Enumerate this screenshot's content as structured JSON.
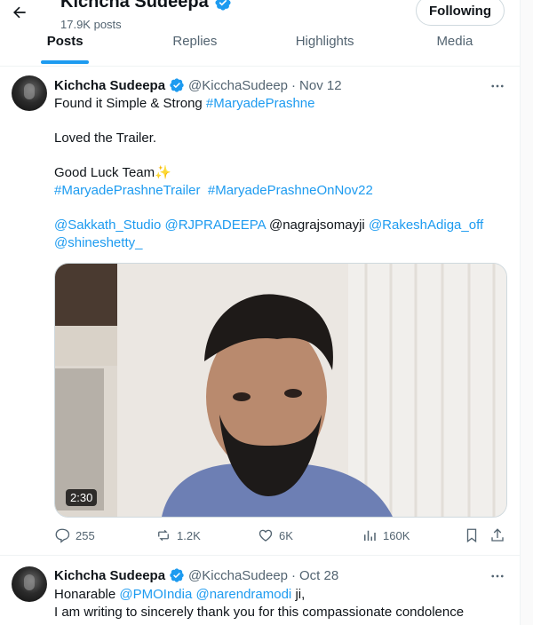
{
  "header": {
    "title": "Kichcha Sudeepa",
    "posts_count": "17.9K posts",
    "follow_label": "Following",
    "verified_color": "#1d9bf0"
  },
  "tabs": [
    {
      "label": "Posts",
      "active": true
    },
    {
      "label": "Replies",
      "active": false
    },
    {
      "label": "Highlights",
      "active": false
    },
    {
      "label": "Media",
      "active": false
    }
  ],
  "posts": [
    {
      "author": "Kichcha Sudeepa",
      "handle": "@KicchaSudeep",
      "separator": "·",
      "date": "Nov 12",
      "text_line1_prefix": "Found it Simple & Strong ",
      "text_line1_tag": "#MaryadePrashne",
      "text_line2": "Loved the Trailer.",
      "text_line3": "Good Luck Team",
      "text_line3_emoji": "✨",
      "tag_a": "#MaryadePrashneTrailer",
      "tag_b": "#MaryadePrashneOnNov22",
      "mention_1": "@Sakkath_Studio",
      "mention_2": "@RJPRADEEPA",
      "mention_3": "@nagrajsomayji",
      "mention_4": "@RakeshAdiga_off",
      "mention_5": "@shineshetty_",
      "video_duration": "2:30",
      "stats": {
        "replies": "255",
        "reposts": "1.2K",
        "likes": "6K",
        "views": "160K"
      }
    },
    {
      "author": "Kichcha Sudeepa",
      "handle": "@KicchaSudeep",
      "separator": "·",
      "date": "Oct 28",
      "text_prefix": "Honarable ",
      "mention_1": "@PMOIndia",
      "mention_2": "@narendramodi",
      "text_suffix": " ji,",
      "text_line2": "I am writing to sincerely thank you for this compassionate condolence"
    }
  ]
}
